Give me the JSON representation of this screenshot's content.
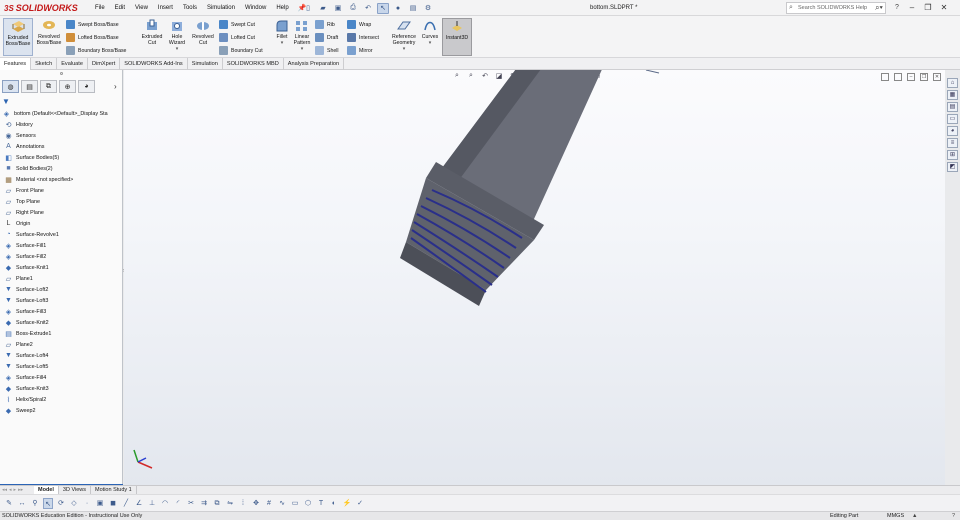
{
  "app": {
    "logo_text": "SOLIDWORKS",
    "logo_prefix": "3S"
  },
  "menu": [
    "File",
    "Edit",
    "View",
    "Insert",
    "Tools",
    "Simulation",
    "Window",
    "Help"
  ],
  "document_title": "bottom.SLDPRT *",
  "search": {
    "placeholder": "Search SOLIDWORKS Help"
  },
  "command_manager": {
    "extruded_boss": "Extruded Boss/Base",
    "revolved_boss": "Revolved Boss/Base",
    "swept_boss": "Swept Boss/Base",
    "lofted_boss": "Lofted Boss/Base",
    "boundary_boss": "Boundary Boss/Base",
    "extruded_cut": "Extruded Cut",
    "hole_wizard": "Hole Wizard",
    "revolved_cut": "Revolved Cut",
    "swept_cut": "Swept Cut",
    "lofted_cut": "Lofted Cut",
    "boundary_cut": "Boundary Cut",
    "fillet": "Fillet",
    "linear_pattern": "Linear Pattern",
    "rib": "Rib",
    "draft": "Draft",
    "shell": "Shell",
    "wrap": "Wrap",
    "intersect": "Intersect",
    "mirror": "Mirror",
    "reference_geometry": "Reference Geometry",
    "curves": "Curves",
    "instant3d": "Instant3D"
  },
  "tabs": [
    "Features",
    "Sketch",
    "Evaluate",
    "DimXpert",
    "SOLIDWORKS Add-Ins",
    "Simulation",
    "SOLIDWORKS MBD",
    "Analysis Preparation"
  ],
  "tree": [
    {
      "label": "bottom  (Default<<Default>_Display Sta",
      "icon": "part-icon"
    },
    {
      "label": "History",
      "icon": "history-icon"
    },
    {
      "label": "Sensors",
      "icon": "sensors-icon"
    },
    {
      "label": "Annotations",
      "icon": "annotations-icon"
    },
    {
      "label": "Surface Bodies(5)",
      "icon": "surface-bodies-icon"
    },
    {
      "label": "Solid Bodies(2)",
      "icon": "solid-bodies-icon"
    },
    {
      "label": "Material <not specified>",
      "icon": "material-icon"
    },
    {
      "label": "Front Plane",
      "icon": "plane-icon"
    },
    {
      "label": "Top Plane",
      "icon": "plane-icon"
    },
    {
      "label": "Right Plane",
      "icon": "plane-icon"
    },
    {
      "label": "Origin",
      "icon": "origin-icon"
    },
    {
      "label": "Surface-Revolve1",
      "icon": "revolve-icon"
    },
    {
      "label": "Surface-Fill1",
      "icon": "fill-icon"
    },
    {
      "label": "Surface-Fill2",
      "icon": "fill-icon"
    },
    {
      "label": "Surface-Knit1",
      "icon": "knit-icon"
    },
    {
      "label": "Plane1",
      "icon": "plane-icon"
    },
    {
      "label": "Surface-Loft2",
      "icon": "loft-icon"
    },
    {
      "label": "Surface-Loft3",
      "icon": "loft-icon"
    },
    {
      "label": "Surface-Fill3",
      "icon": "fill-icon"
    },
    {
      "label": "Surface-Knit2",
      "icon": "knit-icon"
    },
    {
      "label": "Boss-Extrude1",
      "icon": "extrude-icon"
    },
    {
      "label": "Plane2",
      "icon": "plane-icon"
    },
    {
      "label": "Surface-Loft4",
      "icon": "loft-icon"
    },
    {
      "label": "Surface-Loft5",
      "icon": "loft-icon"
    },
    {
      "label": "Surface-Fill4",
      "icon": "fill-icon"
    },
    {
      "label": "Surface-Knit3",
      "icon": "knit-icon"
    },
    {
      "label": "Helix/Spiral2",
      "icon": "helix-icon"
    },
    {
      "label": "Sweep2",
      "icon": "sweep-icon"
    }
  ],
  "bottom_tabs": [
    "Model",
    "3D Views",
    "Motion Study 1"
  ],
  "status": {
    "edition": "SOLIDWORKS Education Edition - Instructional Use Only",
    "mode": "Editing Part",
    "units": "MMGS",
    "caret": "▲",
    "help": "?"
  },
  "colors": {
    "accent": "#2b64b6",
    "brand": "#c41a1a",
    "model": "#5b5e68",
    "thread": "#2a2f8a"
  }
}
